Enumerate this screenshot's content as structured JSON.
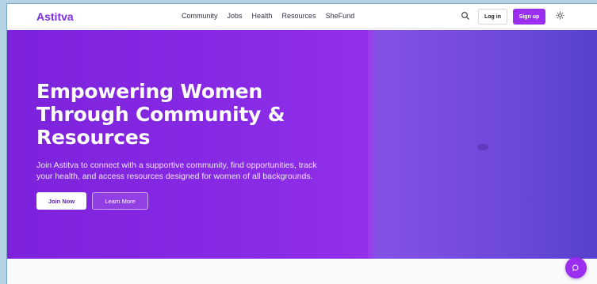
{
  "brand": {
    "name": "Astitva",
    "accent": "#9b2ff0"
  },
  "nav": {
    "links": [
      "Community",
      "Jobs",
      "Health",
      "Resources",
      "SheFund"
    ],
    "login_label": "Log in",
    "signup_label": "Sign up",
    "icons": {
      "search": "search-icon",
      "theme": "sun-icon"
    }
  },
  "hero": {
    "title_lines": [
      "Empowering Women",
      "Through Community &",
      "Resources"
    ],
    "subtitle_lines": [
      "Join Astitva to connect with a supportive community, find opportunities, track",
      "your health, and access resources designed for women of all backgrounds."
    ],
    "primary_cta": "Join Now",
    "secondary_cta": "Learn More",
    "gradient": [
      "#7d22dc",
      "#9330ea",
      "#5642cc"
    ]
  },
  "chat": {
    "icon": "chat-bubble-icon"
  }
}
